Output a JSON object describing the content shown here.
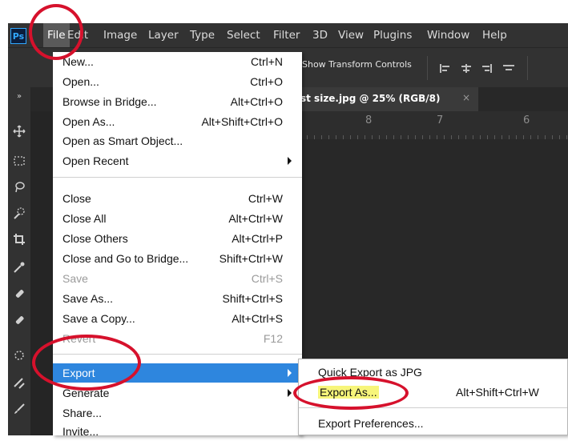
{
  "menubar": {
    "logo": "Ps",
    "items": [
      "File",
      "Edit",
      "Image",
      "Layer",
      "Type",
      "Select",
      "Filter",
      "3D",
      "View",
      "Plugins",
      "Window",
      "Help"
    ]
  },
  "options_bar": {
    "transform_controls_label": "Show Transform Controls"
  },
  "document_tab": {
    "title": "st size.jpg @ 25% (RGB/8)",
    "close": "×"
  },
  "ruler": {
    "labels": [
      "8",
      "7",
      "6"
    ]
  },
  "toolbar": {
    "collapse": "»"
  },
  "file_menu": {
    "items": [
      {
        "label": "New...",
        "shortcut": "Ctrl+N"
      },
      {
        "label": "Open...",
        "shortcut": "Ctrl+O"
      },
      {
        "label": "Browse in Bridge...",
        "shortcut": "Alt+Ctrl+O"
      },
      {
        "label": "Open As...",
        "shortcut": "Alt+Shift+Ctrl+O"
      },
      {
        "label": "Open as Smart Object...",
        "shortcut": ""
      },
      {
        "label": "Open Recent",
        "shortcut": ""
      },
      {
        "label": "Close",
        "shortcut": "Ctrl+W"
      },
      {
        "label": "Close All",
        "shortcut": "Alt+Ctrl+W"
      },
      {
        "label": "Close Others",
        "shortcut": "Alt+Ctrl+P"
      },
      {
        "label": "Close and Go to Bridge...",
        "shortcut": "Shift+Ctrl+W"
      },
      {
        "label": "Save",
        "shortcut": "Ctrl+S"
      },
      {
        "label": "Save As...",
        "shortcut": "Shift+Ctrl+S"
      },
      {
        "label": "Save a Copy...",
        "shortcut": "Alt+Ctrl+S"
      },
      {
        "label": "Revert",
        "shortcut": "F12"
      },
      {
        "label": "Export",
        "shortcut": ""
      },
      {
        "label": "Generate",
        "shortcut": ""
      },
      {
        "label": "Share...",
        "shortcut": ""
      },
      {
        "label": "Invite...",
        "shortcut": ""
      }
    ]
  },
  "export_submenu": {
    "items": [
      {
        "label": "Quick Export as JPG",
        "shortcut": ""
      },
      {
        "label": "Export As...",
        "shortcut": "Alt+Shift+Ctrl+W"
      },
      {
        "label": "Export Preferences...",
        "shortcut": ""
      }
    ]
  },
  "colors": {
    "highlight": "#2e86de",
    "annotation": "#d6112c",
    "text_highlight": "#f7f57a",
    "app_background": "#252525"
  }
}
